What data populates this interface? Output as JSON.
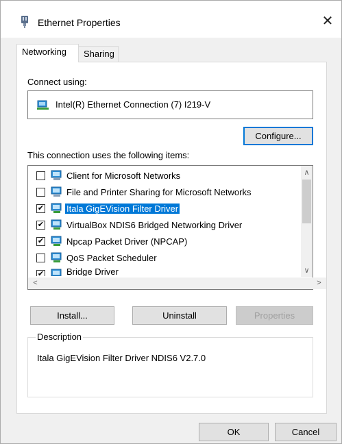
{
  "window": {
    "title": "Ethernet Properties",
    "close_glyph": "✕"
  },
  "tabs": [
    {
      "label": "Networking",
      "active": true
    },
    {
      "label": "Sharing",
      "active": false
    }
  ],
  "connect_using": {
    "label": "Connect using:",
    "adapter": "Intel(R) Ethernet Connection (7) I219-V",
    "configure_label": "Configure..."
  },
  "items_section": {
    "label": "This connection uses the following items:",
    "items": [
      {
        "label": "Client for Microsoft Networks",
        "checked": false,
        "selected": false
      },
      {
        "label": "File and Printer Sharing for Microsoft Networks",
        "checked": false,
        "selected": false
      },
      {
        "label": "Itala GigEVision Filter Driver",
        "checked": true,
        "selected": true
      },
      {
        "label": "VirtualBox NDIS6 Bridged Networking Driver",
        "checked": true,
        "selected": false
      },
      {
        "label": "Npcap Packet Driver (NPCAP)",
        "checked": true,
        "selected": false
      },
      {
        "label": "QoS Packet Scheduler",
        "checked": false,
        "selected": false
      },
      {
        "label": "Bridge Driver",
        "checked": true,
        "selected": false
      }
    ],
    "checkmark": "✔"
  },
  "actions": {
    "install": "Install...",
    "uninstall": "Uninstall",
    "properties": "Properties"
  },
  "description": {
    "label": "Description",
    "text": "Itala GigEVision Filter Driver NDIS6 V2.7.0"
  },
  "footer": {
    "ok": "OK",
    "cancel": "Cancel"
  },
  "colors": {
    "accent": "#0078d7",
    "selection_text": "#ffffff"
  }
}
